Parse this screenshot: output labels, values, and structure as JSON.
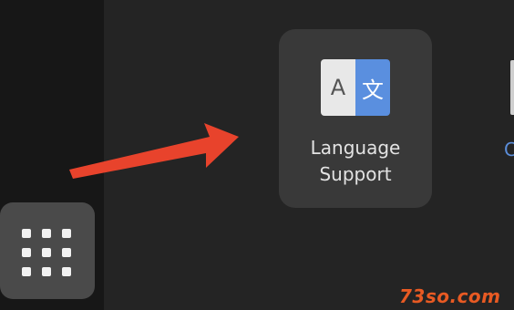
{
  "dock": {
    "apps_button_icon": "grid-dots-icon"
  },
  "app_grid": {
    "app": {
      "label_line1": "Language",
      "label_line2": "Support",
      "icon": "language-translate-icon",
      "icon_left_glyph": "A",
      "icon_right_glyph": "文"
    },
    "next_app_label_partial": "C"
  },
  "annotation": {
    "arrow": "red-pointer-arrow",
    "arrow_color": "#e8432c"
  },
  "watermark": "73so.com",
  "colors": {
    "background": "#242424",
    "dock": "#171717",
    "tile": "#393939",
    "icon_blue": "#5a8fdf",
    "watermark": "#e85a23"
  }
}
